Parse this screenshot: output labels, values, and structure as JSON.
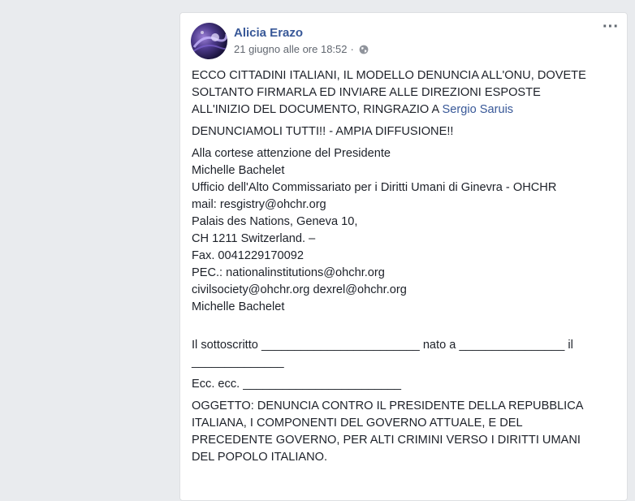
{
  "post": {
    "author": "Alicia Erazo",
    "timestamp": "21 giugno alle ore 18:52",
    "separator": "·",
    "more_label": "···",
    "audience_icon": "globe-icon",
    "intro_lines": [
      "ECCO CITTADINI ITALIANI, IL MODELLO DENUNCIA ALL'ONU, DOVETE",
      "SOLTANTO FIRMARLA ED INVIARE ALLE DIREZIONI ESPOSTE",
      "ALL'INIZIO DEL DOCUMENTO, RINGRAZIO A "
    ],
    "mention": "Sergio Saruis",
    "headline": "DENUNCIAMOLI TUTTI!! - AMPIA DIFFUSIONE!!",
    "address_lines": [
      "Alla cortese attenzione del Presidente",
      "Michelle Bachelet",
      "Ufficio dell'Alto Commissariato per i Diritti Umani di Ginevra - OHCHR",
      "mail: resgistry@ohchr.org",
      "Palais des Nations, Geneva 10,",
      "CH 1211 Switzerland. –",
      "Fax. 0041229170092",
      "PEC.: nationalinstitutions@ohchr.org",
      "civilsociety@ohchr.org dexrel@ohchr.org",
      "Michelle Bachelet"
    ],
    "signature_lines": [
      "Il sottoscritto ________________________ nato a ________________ il",
      "______________"
    ],
    "ecc_line": "Ecc. ecc. ________________________",
    "subject_lines": [
      "OGGETTO: DENUNCIA CONTRO IL PRESIDENTE DELLA REPUBBLICA",
      "ITALIANA, I COMPONENTI DEL GOVERNO ATTUALE, E DEL",
      "PRECEDENTE GOVERNO, PER ALTI CRIMINI VERSO I DIRITTI UMANI",
      "DEL POPOLO ITALIANO."
    ]
  }
}
